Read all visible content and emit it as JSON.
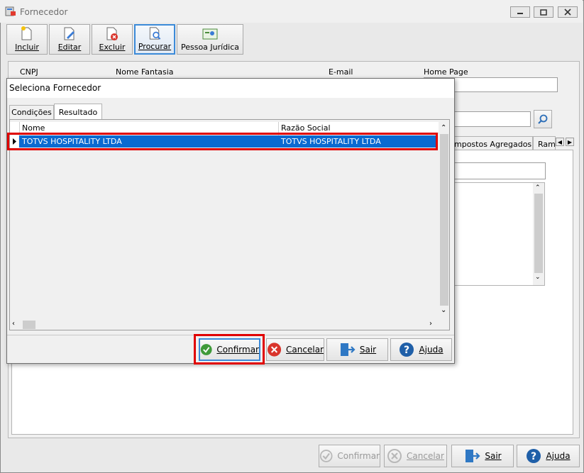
{
  "window": {
    "title": "Fornecedor"
  },
  "toolbar": {
    "incluir": "Incluir",
    "editar": "Editar",
    "excluir": "Excluir",
    "procurar": "Procurar",
    "pessoa_juridica": "Pessoa Jurídica"
  },
  "form": {
    "cnpj_label": "CNPJ",
    "nome_fantasia_label": "Nome Fantasia",
    "email_label": "E-mail",
    "home_page_label": "Home Page",
    "tab_impostos": "mpostos Agregados",
    "tab_ramo": "Ramo"
  },
  "dialog": {
    "title": "Seleciona Fornecedor",
    "tabs": [
      "Condições",
      "Resultado"
    ],
    "columns": [
      "Nome",
      "Razão Social"
    ],
    "rows": [
      {
        "nome": "TOTVS HOSPITALITY LTDA",
        "razao_social": "TOTVS HOSPITALITY LTDA"
      }
    ],
    "buttons": {
      "confirmar": "Confirmar",
      "cancelar": "Cancelar",
      "sair": "Sair",
      "ajuda": "Ajuda"
    }
  },
  "bottom_bar": {
    "confirmar": "Confirmar",
    "cancelar": "Cancelar",
    "sair": "Sair",
    "ajuda": "Ajuda"
  },
  "colors": {
    "selection": "#0a6ad1",
    "highlight": "#e00000",
    "active_border": "#3b8ad8"
  }
}
